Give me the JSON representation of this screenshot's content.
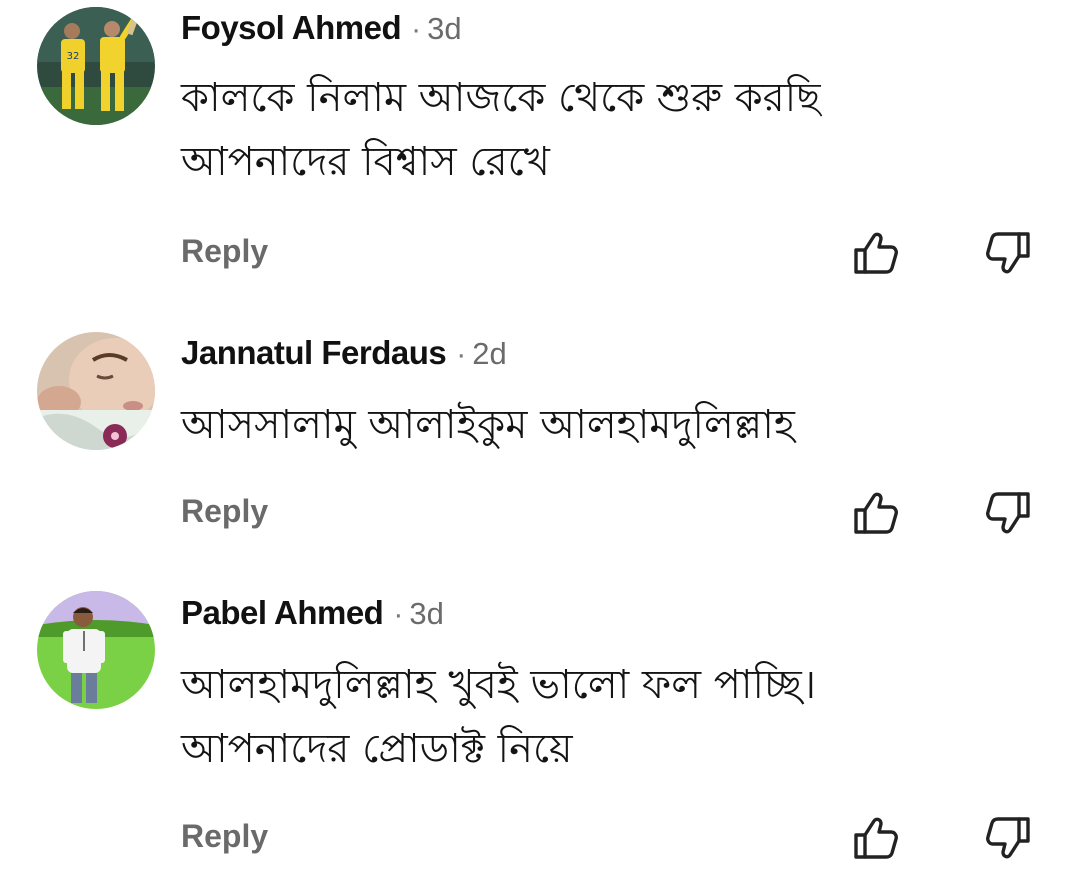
{
  "comments": [
    {
      "author": "Foysol Ahmed",
      "separator": "·",
      "time": "3d",
      "text": "কালকে নিলাম আজকে থেকে শুরু করছি\nআপনাদের বিশ্বাস রেখে",
      "reply_label": "Reply",
      "avatar_icon": "cricket-players-avatar"
    },
    {
      "author": "Jannatul Ferdaus",
      "separator": "·",
      "time": "2d",
      "text": "আসসালামু আলাইকুম আলহামদুলিল্লাহ",
      "reply_label": "Reply",
      "avatar_icon": "sleeping-baby-avatar"
    },
    {
      "author": "Pabel Ahmed",
      "separator": "·",
      "time": "3d",
      "text": "আলহামদুলিল্লাহ খুবই ভালো ফল পাচ্ছি।\nআপনাদের প্রোডাক্ট নিয়ে",
      "reply_label": "Reply",
      "avatar_icon": "man-in-field-avatar"
    }
  ],
  "icons": {
    "like": "thumbs-up-outline-icon",
    "dislike": "thumbs-down-outline-icon"
  },
  "colors": {
    "author": "#111111",
    "meta": "#6b6b6b",
    "reply": "#6a6a6a",
    "icon_stroke": "#222222"
  }
}
